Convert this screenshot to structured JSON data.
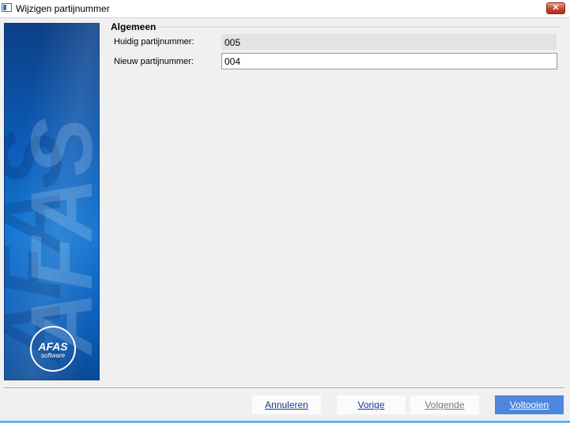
{
  "window": {
    "title": "Wijzigen partijnummer",
    "close_label": "✕"
  },
  "branding": {
    "watermark": "AFAS",
    "logo_main": "AFAS",
    "logo_sub": "software"
  },
  "group": {
    "title": "Algemeen"
  },
  "fields": {
    "current_label": "Huidig partijnummer:",
    "current_value": "005",
    "new_label": "Nieuw partijnummer:",
    "new_value": "004"
  },
  "buttons": {
    "cancel": "Annuleren",
    "previous": "Vorige",
    "next": "Volgende",
    "finish": "Voltooien"
  },
  "colors": {
    "primary_button": "#4f86de",
    "sidebar_blue": "#0b5cb8"
  }
}
